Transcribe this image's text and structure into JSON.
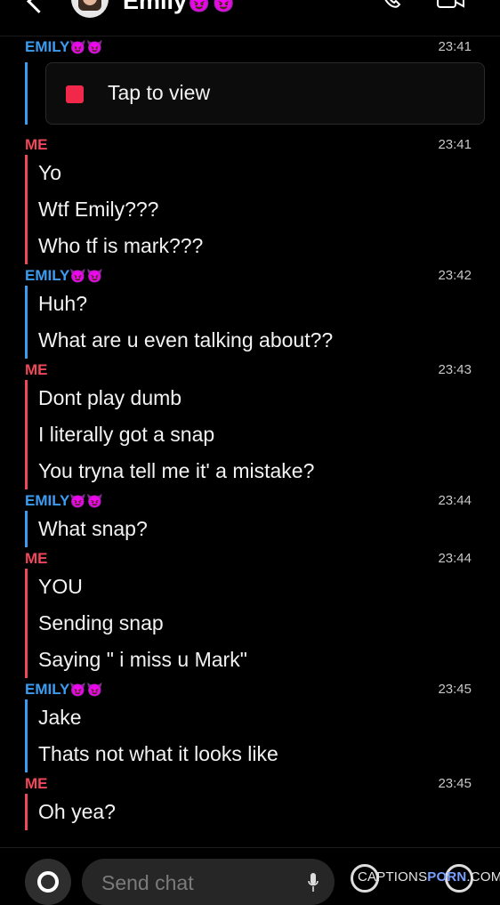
{
  "header": {
    "name": "Emily",
    "emojis": "😈😈"
  },
  "chat": [
    {
      "sender": "EMILY",
      "emojis": "😈😈",
      "time": "23:41",
      "snap": "Tap to view",
      "messages": []
    },
    {
      "sender": "ME",
      "time": "23:41",
      "messages": [
        "Yo",
        "Wtf Emily???",
        "Who tf is mark???"
      ]
    },
    {
      "sender": "EMILY",
      "emojis": "😈😈",
      "time": "23:42",
      "messages": [
        "Huh?",
        "What are u even talking about??"
      ]
    },
    {
      "sender": "ME",
      "time": "23:43",
      "messages": [
        "Dont play dumb",
        "I literally got a snap",
        "You tryna tell me it'  a mistake?"
      ]
    },
    {
      "sender": "EMILY",
      "emojis": "😈😈",
      "time": "23:44",
      "messages": [
        "What snap?"
      ]
    },
    {
      "sender": "ME",
      "time": "23:44",
      "messages": [
        "YOU",
        "Sending snap",
        "Saying \" i miss u Mark\""
      ]
    },
    {
      "sender": "EMILY",
      "emojis": "😈😈",
      "time": "23:45",
      "messages": [
        "Jake",
        "Thats not what it looks like"
      ]
    },
    {
      "sender": "ME",
      "time": "23:45",
      "messages": [
        "Oh yea?"
      ]
    }
  ],
  "composer": {
    "placeholder": "Send chat"
  },
  "watermark": {
    "left": "CAPTIONS",
    "mid": "PORN",
    "right": ".COM"
  },
  "colors": {
    "emily": "#3b9cf0",
    "me": "#f0475a",
    "snap": "#f2284a"
  }
}
